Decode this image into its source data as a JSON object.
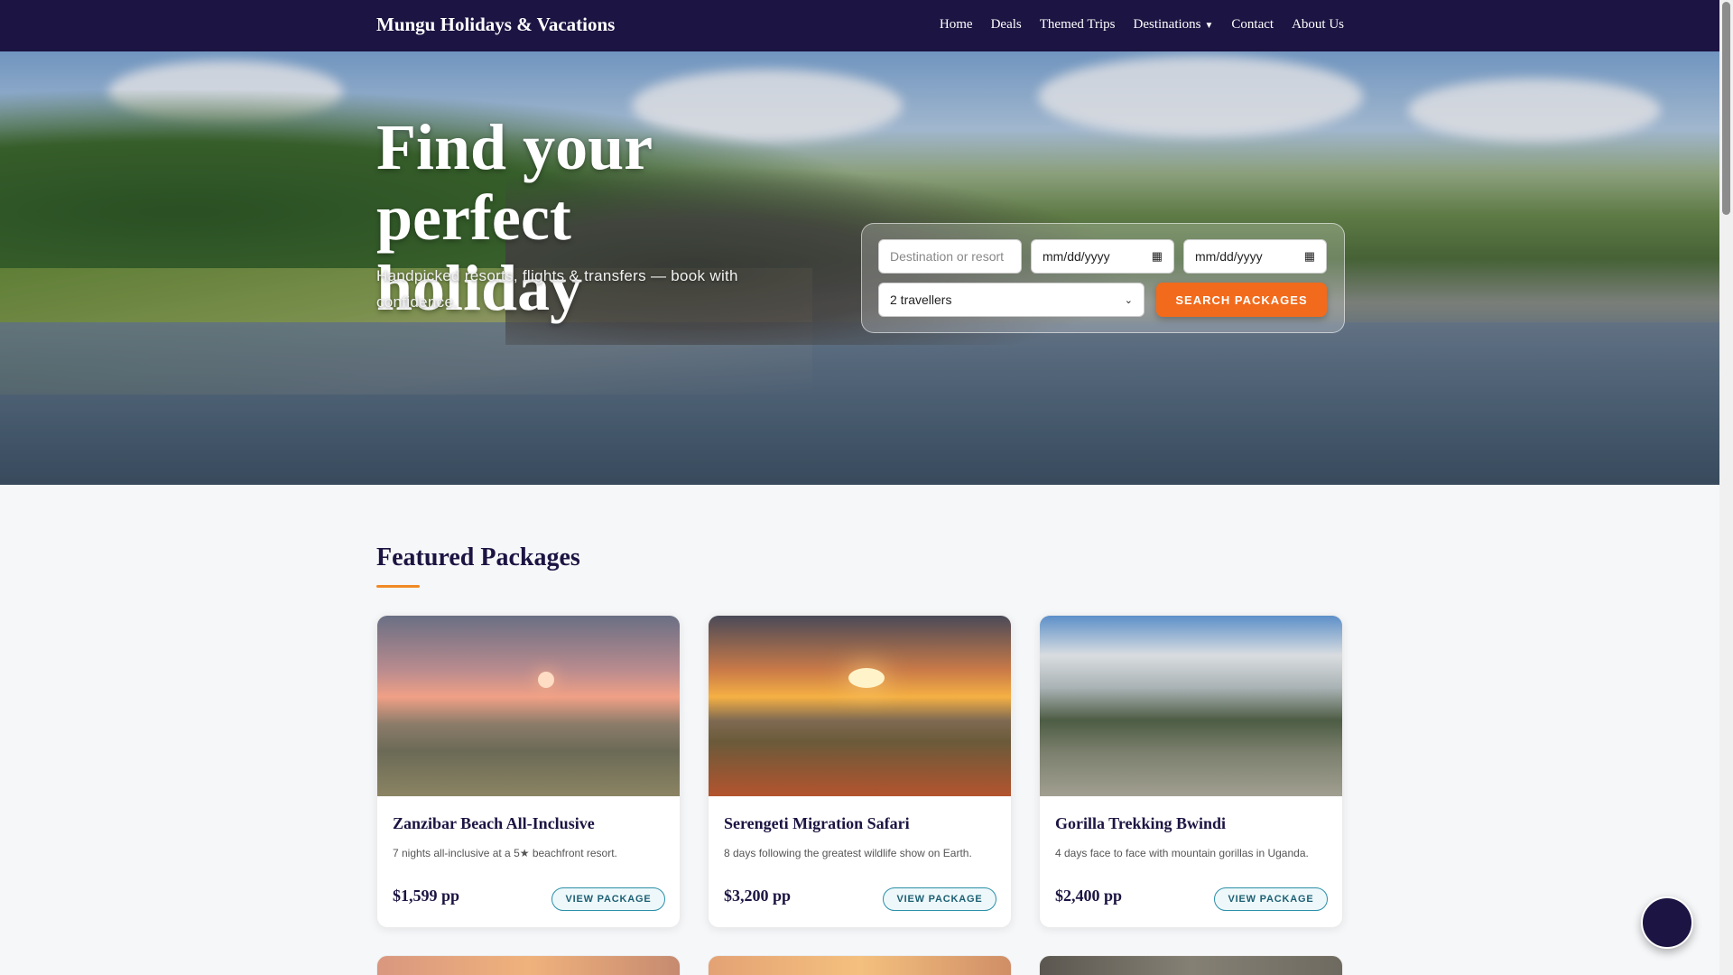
{
  "nav": {
    "brand": "Mungu Holidays & Vacations",
    "links": {
      "home": "Home",
      "deals": "Deals",
      "themed": "Themed Trips",
      "destinations": "Destinations",
      "contact": "Contact",
      "about": "About Us"
    }
  },
  "hero": {
    "title": "Find your perfect holiday",
    "subtitle": "Handpicked resorts, flights & transfers — book with confidence."
  },
  "search": {
    "destination_placeholder": "Destination or resort",
    "date_from": "mm/dd/yyyy",
    "date_to": "mm/dd/yyyy",
    "travellers": "2 travellers",
    "button": "SEARCH PACKAGES"
  },
  "featured": {
    "title": "Featured Packages",
    "cards": [
      {
        "title": "Zanzibar Beach All-Inclusive",
        "desc": "7 nights all-inclusive at a 5★ beachfront resort.",
        "price": "$1,599 pp",
        "button": "VIEW PACKAGE"
      },
      {
        "title": "Serengeti Migration Safari",
        "desc": "8 days following the greatest wildlife show on Earth.",
        "price": "$3,200 pp",
        "button": "VIEW PACKAGE"
      },
      {
        "title": "Gorilla Trekking Bwindi",
        "desc": "4 days face to face with mountain gorillas in Uganda.",
        "price": "$2,400 pp",
        "button": "VIEW PACKAGE"
      }
    ]
  },
  "icons": {
    "dropdown": "chevron-down-icon",
    "calendar": "calendar-icon",
    "chat": "chat-icon"
  },
  "colors": {
    "nav_bg": "#1c1442",
    "accent": "#f26a1b",
    "underline": "#f08a24",
    "button_border": "#2b8fa8"
  }
}
